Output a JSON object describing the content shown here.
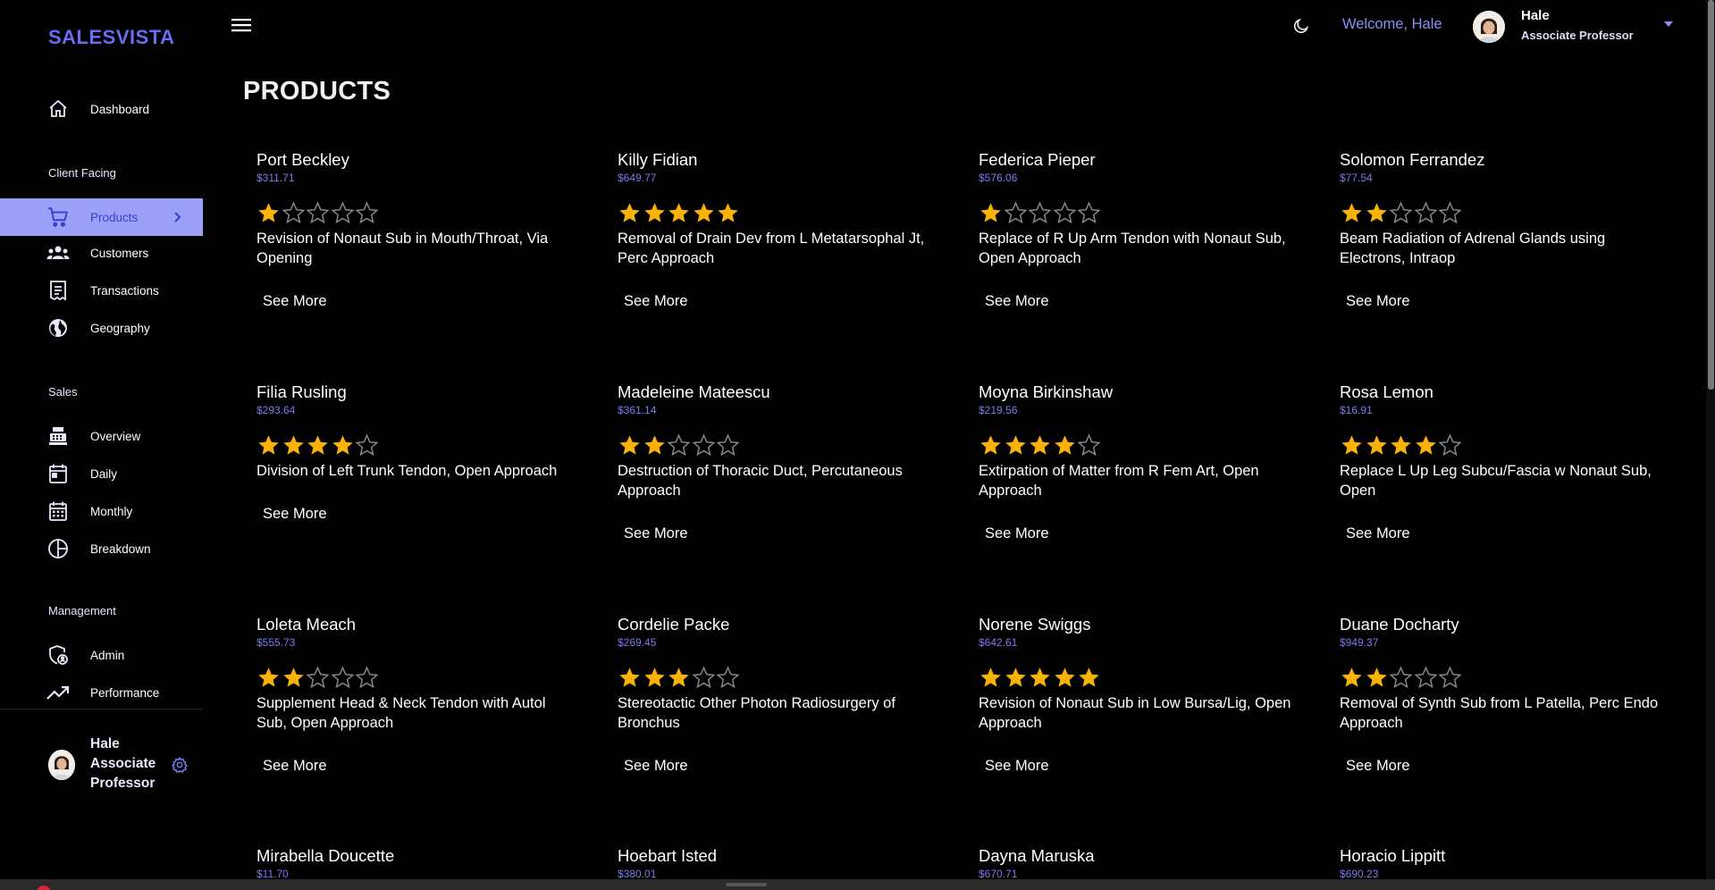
{
  "app": {
    "brand": "SALESVISTA",
    "page_title": "PRODUCTS"
  },
  "sidebar": {
    "dashboard": "Dashboard",
    "sections": {
      "client_facing": "Client Facing",
      "sales": "Sales",
      "management": "Management"
    },
    "items": {
      "products": "Products",
      "customers": "Customers",
      "transactions": "Transactions",
      "geography": "Geography",
      "overview": "Overview",
      "daily": "Daily",
      "monthly": "Monthly",
      "breakdown": "Breakdown",
      "admin": "Admin",
      "performance": "Performance"
    },
    "active_item": "Products",
    "profile": {
      "name": "Hale",
      "role_line1": "Associate",
      "role_line2": "Professor"
    }
  },
  "header": {
    "welcome": "Welcome, Hale",
    "name": "Hale",
    "role": "Associate Professor"
  },
  "colors": {
    "accent": "#6b6bf3",
    "active_bg": "#9aa1f6",
    "star": "#f9b208",
    "price": "#7b7bf0"
  },
  "products": [
    {
      "name": "Port Beckley",
      "price": "$311.71",
      "rating": 1,
      "description": "Revision of Nonaut Sub in Mouth/Throat, Via Opening",
      "cta": "See More"
    },
    {
      "name": "Killy Fidian",
      "price": "$649.77",
      "rating": 5,
      "description": "Removal of Drain Dev from L Metatarsophal Jt, Perc Approach",
      "cta": "See More"
    },
    {
      "name": "Federica Pieper",
      "price": "$576.06",
      "rating": 1,
      "description": "Replace of R Up Arm Tendon with Nonaut Sub, Open Approach",
      "cta": "See More"
    },
    {
      "name": "Solomon Ferrandez",
      "price": "$77.54",
      "rating": 2,
      "description": "Beam Radiation of Adrenal Glands using Electrons, Intraop",
      "cta": "See More"
    },
    {
      "name": "Filia Rusling",
      "price": "$293.64",
      "rating": 4,
      "description": "Division of Left Trunk Tendon, Open Approach",
      "cta": "See More"
    },
    {
      "name": "Madeleine Mateescu",
      "price": "$361.14",
      "rating": 2,
      "description": "Destruction of Thoracic Duct, Percutaneous Approach",
      "cta": "See More"
    },
    {
      "name": "Moyna Birkinshaw",
      "price": "$219.56",
      "rating": 4,
      "description": "Extirpation of Matter from R Fem Art, Open Approach",
      "cta": "See More"
    },
    {
      "name": "Rosa Lemon",
      "price": "$16.91",
      "rating": 4,
      "description": "Replace L Up Leg Subcu/Fascia w Nonaut Sub, Open",
      "cta": "See More"
    },
    {
      "name": "Loleta Meach",
      "price": "$555.73",
      "rating": 2,
      "description": "Supplement Head & Neck Tendon with Autol Sub, Open Approach",
      "cta": "See More"
    },
    {
      "name": "Cordelie Packe",
      "price": "$269.45",
      "rating": 3,
      "description": "Stereotactic Other Photon Radiosurgery of Bronchus",
      "cta": "See More"
    },
    {
      "name": "Norene Swiggs",
      "price": "$642.61",
      "rating": 5,
      "description": "Revision of Nonaut Sub in Low Bursa/Lig, Open Approach",
      "cta": "See More"
    },
    {
      "name": "Duane Docharty",
      "price": "$949.37",
      "rating": 2,
      "description": "Removal of Synth Sub from L Patella, Perc Endo Approach",
      "cta": "See More"
    },
    {
      "name": "Mirabella Doucette",
      "price": "$11.70",
      "rating": 0,
      "description": "",
      "cta": ""
    },
    {
      "name": "Hoebart Isted",
      "price": "$380.01",
      "rating": 0,
      "description": "",
      "cta": ""
    },
    {
      "name": "Dayna Maruska",
      "price": "$670.71",
      "rating": 0,
      "description": "",
      "cta": ""
    },
    {
      "name": "Horacio Lippitt",
      "price": "$690.23",
      "rating": 0,
      "description": "",
      "cta": ""
    }
  ]
}
